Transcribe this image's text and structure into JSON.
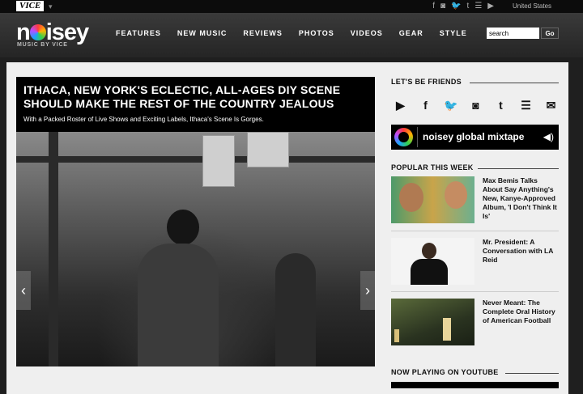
{
  "topbar": {
    "brand": "VICE",
    "brand_chevron": "▾",
    "social_icons": [
      "facebook-icon",
      "instagram-icon",
      "twitter-icon",
      "tumblr-icon",
      "rss-icon",
      "youtube-icon"
    ],
    "region": "United States"
  },
  "header": {
    "logo": "noisey",
    "tagline": "MUSIC BY VICE",
    "nav": [
      "FEATURES",
      "NEW MUSIC",
      "REVIEWS",
      "PHOTOS",
      "VIDEOS",
      "GEAR",
      "STYLE"
    ],
    "search_value": "search",
    "go_label": "Go"
  },
  "feature": {
    "title": "ITHACA, NEW YORK'S ECLECTIC, ALL-AGES DIY SCENE SHOULD MAKE THE REST OF THE COUNTRY JEALOUS",
    "subtitle": "With a Packed Roster of Live Shows and Exciting Labels, Ithaca's Scene Is Gorges.",
    "prev_arrow": "‹",
    "next_arrow": "›"
  },
  "sidebar": {
    "friends_heading": "LET'S BE FRIENDS",
    "social": [
      {
        "name": "youtube-icon",
        "glyph": "▶"
      },
      {
        "name": "facebook-icon",
        "glyph": "f"
      },
      {
        "name": "twitter-icon",
        "glyph": "🐦"
      },
      {
        "name": "instagram-icon",
        "glyph": "◙"
      },
      {
        "name": "tumblr-icon",
        "glyph": "t"
      },
      {
        "name": "rss-icon",
        "glyph": "☰"
      },
      {
        "name": "mail-icon",
        "glyph": "✉"
      }
    ],
    "mixtape_label": "noisey global mixtape",
    "mixtape_speaker": "◀)",
    "popular_heading": "POPULAR THIS WEEK",
    "popular": [
      {
        "title": "Max Bemis Talks About Say Anything's New, Kanye-Approved Album, 'I Don't Think It Is'"
      },
      {
        "title": "Mr. President: A Conversation with LA Reid"
      },
      {
        "title": "Never Meant: The Complete Oral History of American Football"
      }
    ],
    "nowplaying_heading": "NOW PLAYING ON YOUTUBE"
  },
  "colors": {
    "page_bg": "#1f1f1f",
    "content_bg": "#efefef",
    "header_bg": "#2e2e2e",
    "accent": "#000000"
  }
}
